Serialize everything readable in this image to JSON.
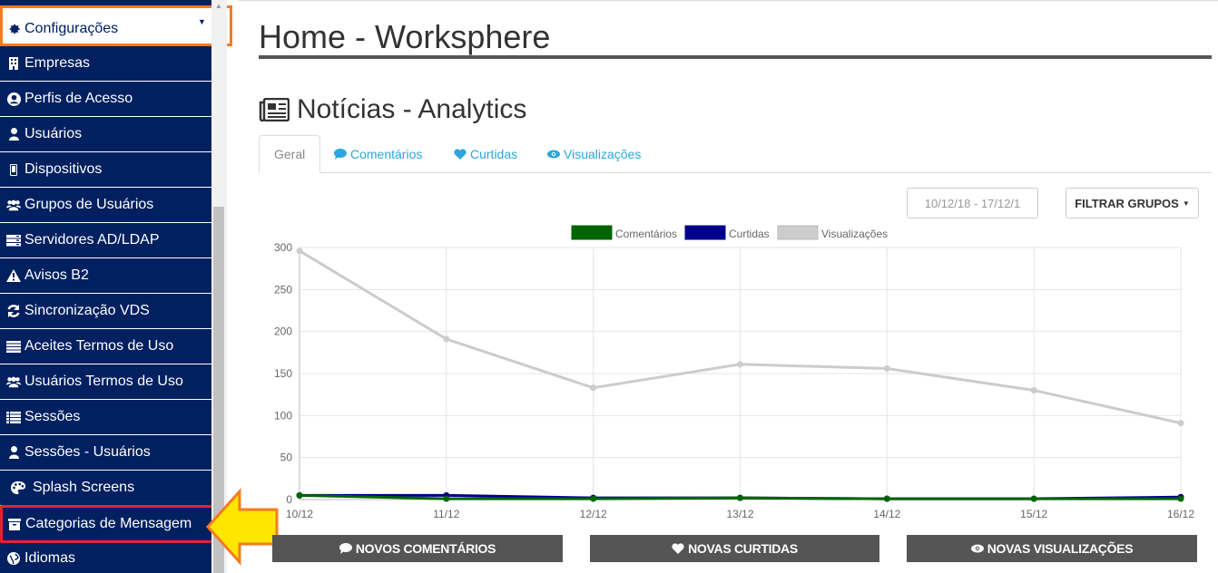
{
  "sidebar": {
    "top_label": "Configurações",
    "items": [
      {
        "label": "Empresas",
        "icon": "building-icon"
      },
      {
        "label": "Perfis de Acesso",
        "icon": "user-circle-icon"
      },
      {
        "label": "Usuários",
        "icon": "user-icon"
      },
      {
        "label": "Dispositivos",
        "icon": "mobile-icon"
      },
      {
        "label": "Grupos de Usuários",
        "icon": "users-icon"
      },
      {
        "label": "Servidores AD/LDAP",
        "icon": "server-icon"
      },
      {
        "label": "Avisos B2",
        "icon": "warning-icon"
      },
      {
        "label": "Sincronização VDS",
        "icon": "refresh-icon"
      },
      {
        "label": "Aceites Termos de Uso",
        "icon": "list-icon"
      },
      {
        "label": "Usuários Termos de Uso",
        "icon": "users-icon"
      },
      {
        "label": "Sessões",
        "icon": "list-alt-icon"
      },
      {
        "label": "Sessões - Usuários",
        "icon": "user-icon"
      },
      {
        "label": "Splash Screens",
        "icon": "palette-icon"
      },
      {
        "label": "Categorias de Mensagem",
        "icon": "archive-icon"
      },
      {
        "label": "Idiomas",
        "icon": "globe-icon"
      }
    ]
  },
  "header": {
    "title": "Home - Worksphere"
  },
  "section": {
    "title": "Notícias - Analytics"
  },
  "tabs": [
    {
      "label": "Geral",
      "icon": ""
    },
    {
      "label": "Comentários",
      "icon": "comment-icon"
    },
    {
      "label": "Curtidas",
      "icon": "heart-icon"
    },
    {
      "label": "Visualizações",
      "icon": "eye-icon"
    }
  ],
  "controls": {
    "date_range": "10/12/18 - 17/12/1",
    "filter_label": "FILTRAR GRUPOS"
  },
  "chart_data": {
    "type": "line",
    "x": [
      "10/12",
      "11/12",
      "12/12",
      "13/12",
      "14/12",
      "15/12",
      "16/12"
    ],
    "series": [
      {
        "name": "Comentários",
        "color": "#006400",
        "values": [
          5,
          1,
          1,
          2,
          1,
          1,
          1
        ]
      },
      {
        "name": "Curtidas",
        "color": "#00008b",
        "values": [
          5,
          5,
          2,
          2,
          1,
          1,
          3
        ]
      },
      {
        "name": "Visualizações",
        "color": "#cccccc",
        "values": [
          296,
          191,
          133,
          161,
          156,
          130,
          91
        ]
      }
    ],
    "ylim": [
      0,
      300
    ],
    "yticks": [
      0,
      50,
      100,
      150,
      200,
      250,
      300
    ],
    "grid": true,
    "legend": "top-center"
  },
  "stats": {
    "comments_label": "NOVOS COMENTÁRIOS",
    "likes_label": "NOVAS CURTIDAS",
    "views_label": "NOVAS VISUALIZAÇÕES"
  }
}
